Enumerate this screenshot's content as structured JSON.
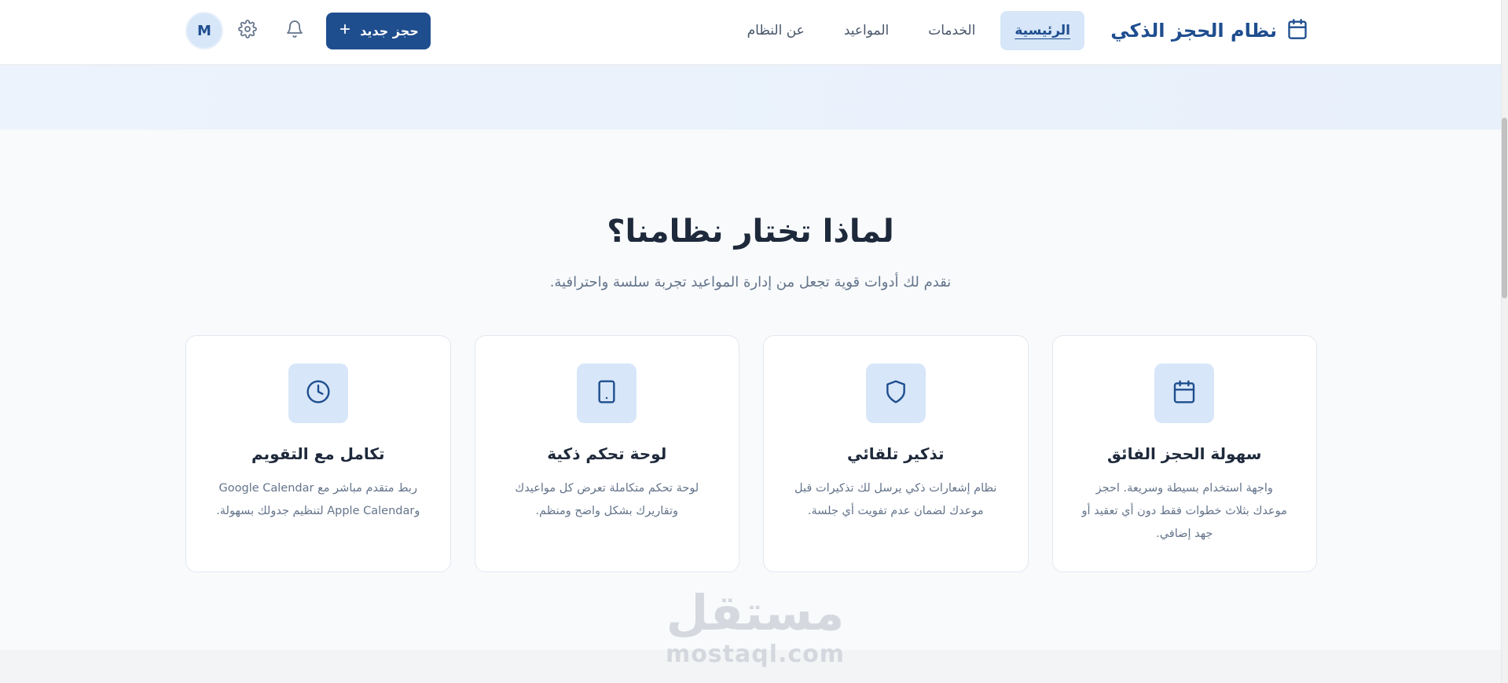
{
  "header": {
    "brand_title": "نظام الحجز الذكي",
    "brand_icon": "calendar-icon",
    "nav": [
      {
        "label": "الرئيسية",
        "active": true
      },
      {
        "label": "الخدمات",
        "active": false
      },
      {
        "label": "المواعيد",
        "active": false
      },
      {
        "label": "عن النظام",
        "active": false
      }
    ],
    "new_booking_label": "حجز جديد",
    "avatar_initial": "M",
    "icons": [
      "bell-icon",
      "gear-icon",
      "plus-icon"
    ]
  },
  "features": {
    "title": "لماذا تختار نظامنا؟",
    "subtitle": "نقدم لك أدوات قوية تجعل من إدارة المواعيد تجربة سلسة واحترافية.",
    "cards": [
      {
        "icon": "calendar-icon",
        "title": "سهولة الحجز الفائق",
        "desc": "واجهة استخدام بسيطة وسريعة. احجز موعدك بثلاث خطوات فقط دون أي تعقيد أو جهد إضافي."
      },
      {
        "icon": "shield-icon",
        "title": "تذكير تلقائي",
        "desc": "نظام إشعارات ذكي يرسل لك تذكيرات قبل موعدك لضمان عدم تفويت أي جلسة."
      },
      {
        "icon": "tablet-icon",
        "title": "لوحة تحكم ذكية",
        "desc": "لوحة تحكم متكاملة تعرض كل مواعيدك وتقاريرك بشكل واضح ومنظم."
      },
      {
        "icon": "clock-icon",
        "title": "تكامل مع التقويم",
        "desc": "ربط متقدم مباشر مع Google Calendar وApple Calendar لتنظيم جدولك بسهولة."
      }
    ]
  },
  "watermark": {
    "arabic": "مستقل",
    "latin": "mostaql.com"
  },
  "colors": {
    "primary": "#1f4e8f",
    "accent_bg": "#d7e6f8",
    "page_bg": "#f8fafc"
  }
}
